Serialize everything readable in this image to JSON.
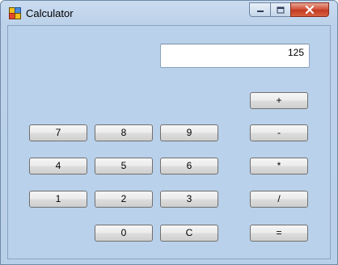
{
  "window": {
    "title": "Calculator"
  },
  "display": {
    "value": "125"
  },
  "keys": {
    "plus": "+",
    "minus": "-",
    "multiply": "*",
    "divide": "/",
    "equals": "=",
    "clear": "C",
    "d0": "0",
    "d1": "1",
    "d2": "2",
    "d3": "3",
    "d4": "4",
    "d5": "5",
    "d6": "6",
    "d7": "7",
    "d8": "8",
    "d9": "9"
  },
  "colors": {
    "window_background": "#b9d1ea",
    "display_background": "#ffffff",
    "close_button": "#c94a30"
  },
  "icons": [
    "calculator-app-icon",
    "minimize-icon",
    "maximize-icon",
    "close-icon"
  ]
}
